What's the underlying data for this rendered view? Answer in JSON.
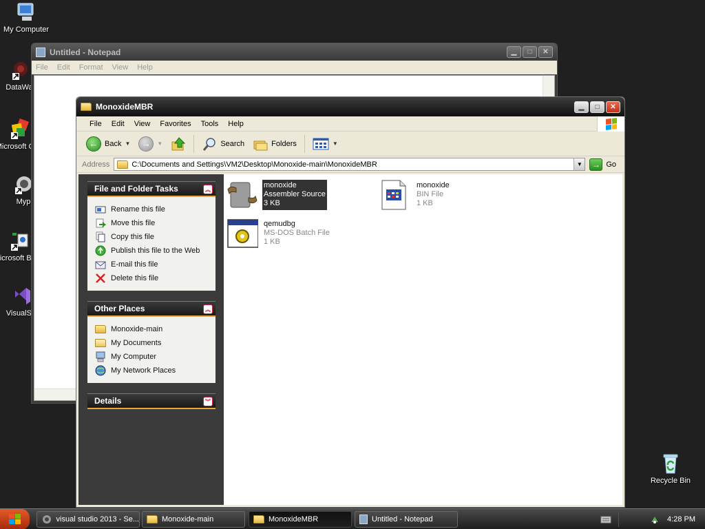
{
  "desktop": {
    "icons": [
      {
        "label": "My Computer"
      },
      {
        "label": "DataWa"
      },
      {
        "label": "Microsoft C++"
      },
      {
        "label": "Myp"
      },
      {
        "label": "Microsoft Basic"
      },
      {
        "label": "VisualStu"
      },
      {
        "label": "Recycle Bin"
      }
    ]
  },
  "notepad": {
    "title": "Untitled - Notepad",
    "menu": [
      "File",
      "Edit",
      "Format",
      "View",
      "Help"
    ]
  },
  "explorer": {
    "title": "MonoxideMBR",
    "menu": [
      "File",
      "Edit",
      "View",
      "Favorites",
      "Tools",
      "Help"
    ],
    "toolbar": {
      "back": "Back",
      "search": "Search",
      "folders": "Folders"
    },
    "address": {
      "label": "Address",
      "path": "C:\\Documents and Settings\\VM2\\Desktop\\Monoxide-main\\MonoxideMBR",
      "go": "Go"
    },
    "tasks": {
      "title": "File and Folder Tasks",
      "items": [
        "Rename this file",
        "Move this file",
        "Copy this file",
        "Publish this file to the Web",
        "E-mail this file",
        "Delete this file"
      ]
    },
    "other_places": {
      "title": "Other Places",
      "items": [
        "Monoxide-main",
        "My Documents",
        "My Computer",
        "My Network Places"
      ]
    },
    "details": {
      "title": "Details"
    },
    "files": [
      {
        "name": "monoxide",
        "type": "Assembler Source",
        "size": "3 KB",
        "icon": "assembler-file-icon",
        "selected": true
      },
      {
        "name": "monoxide",
        "type": "BIN File",
        "size": "1 KB",
        "icon": "bin-file-icon",
        "selected": false
      },
      {
        "name": "qemudbg",
        "type": "MS-DOS Batch File",
        "size": "1 KB",
        "icon": "batch-file-icon",
        "selected": false
      }
    ]
  },
  "taskbar": {
    "buttons": [
      "visual studio 2013 - Se...",
      "Monoxide-main",
      "MonoxideMBR",
      "Untitled - Notepad"
    ],
    "clock": "4:28 PM"
  },
  "colors": {
    "accent": "#e9a53a",
    "selection": "#333333",
    "taskpane": "#3b3b3b"
  }
}
